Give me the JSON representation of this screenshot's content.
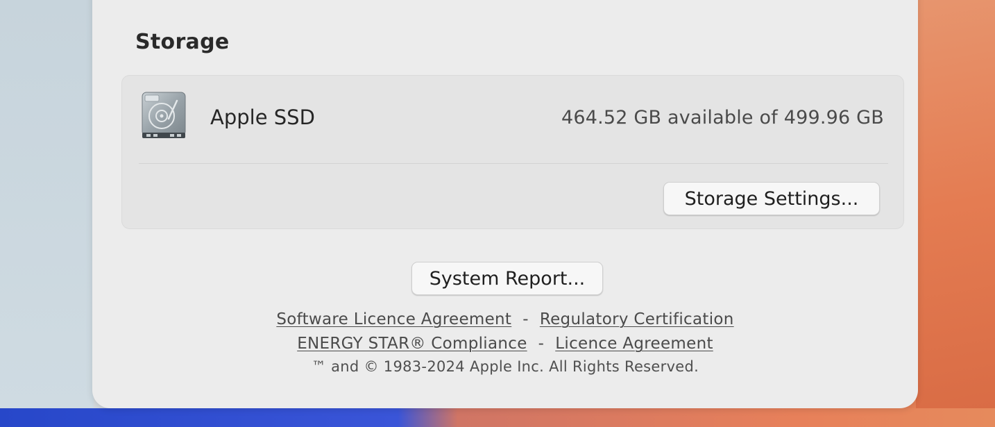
{
  "storage": {
    "title": "Storage",
    "disk_name": "Apple SSD",
    "disk_space": "464.52 GB available of 499.96 GB",
    "settings_button": "Storage Settings..."
  },
  "system_report_button": "System Report...",
  "links": {
    "software_licence": "Software Licence Agreement",
    "regulatory": "Regulatory Certification",
    "energy_star": "ENERGY STAR® Compliance",
    "licence": "Licence Agreement",
    "separator": "-"
  },
  "copyright": "™ and © 1983-2024 Apple Inc. All Rights Reserved.",
  "icons": {
    "disk": "hard-drive-icon"
  },
  "colors": {
    "window_bg": "#ececec",
    "group_bg": "#e4e4e4",
    "button_bg": "#f7f7f7",
    "text": "#262626"
  }
}
